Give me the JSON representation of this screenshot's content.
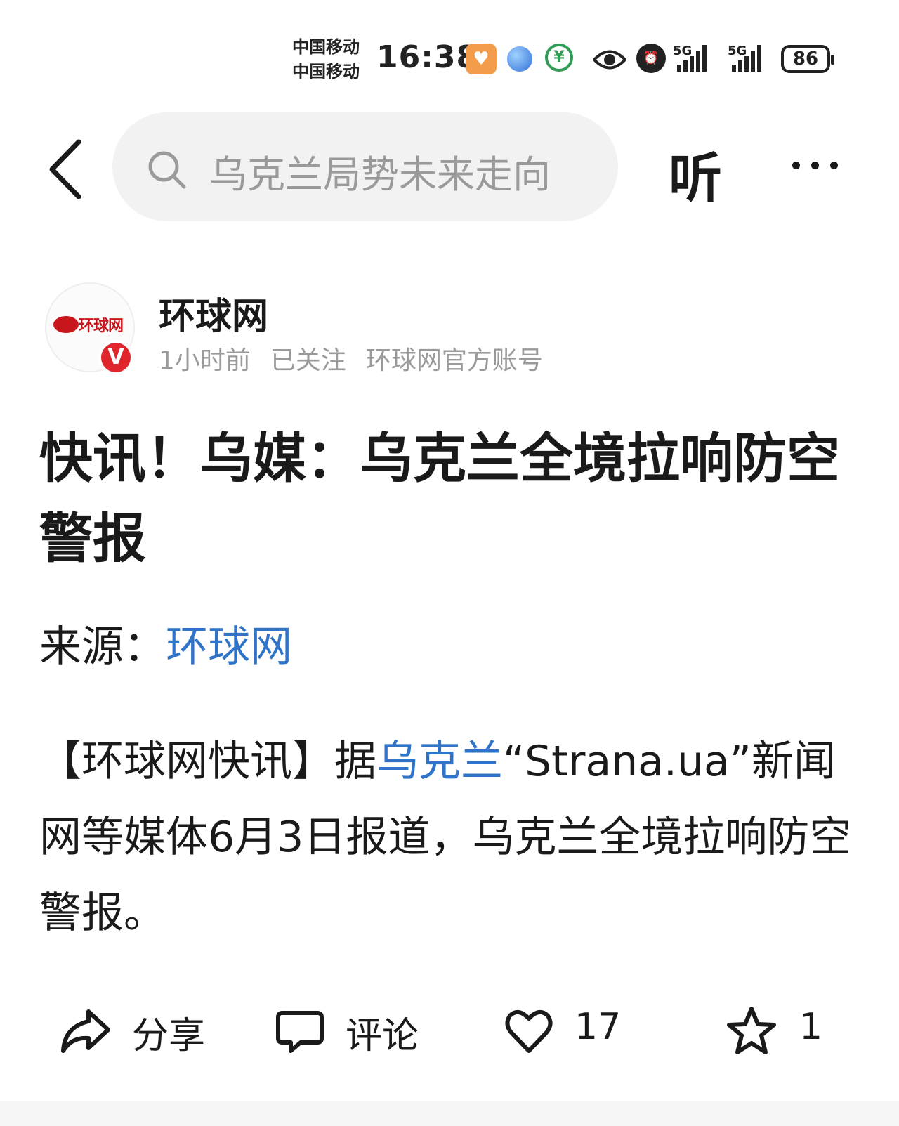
{
  "status_bar": {
    "carrier_1": "中国移动",
    "carrier_2": "中国移动",
    "time": "16:38",
    "network_1": "5G",
    "network_2": "5G",
    "battery": "86",
    "icons": [
      "app-heart-icon",
      "browser-planet-icon",
      "bank-app-icon",
      "eye-comfort-icon",
      "alarm-icon",
      "signal-icon",
      "signal-icon",
      "battery-icon"
    ]
  },
  "nav": {
    "search_text": "乌克兰局势未来走向",
    "listen_label": "听"
  },
  "author": {
    "name": "环球网",
    "logo_text": "环球网",
    "badge": "V",
    "time": "1小时前",
    "follow_status": "已关注",
    "description": "环球网官方账号"
  },
  "article": {
    "title": "快讯！乌媒：乌克兰全境拉响防空警报",
    "source_label": "来源：",
    "source_name": "环球网",
    "body_prefix": "【环球网快讯】据",
    "body_link": "乌克兰",
    "body_suffix": "“Strana.ua”新闻网等媒体6月3日报道，乌克兰全境拉响防空警报。"
  },
  "actions": {
    "share_label": "分享",
    "comment_label": "评论",
    "like_count": "17",
    "favorite_count": "1"
  },
  "colors": {
    "link": "#2f74c8",
    "search_bg": "#f2f2f2",
    "badge_red": "#e0262d",
    "brand_red": "#c8161d"
  }
}
